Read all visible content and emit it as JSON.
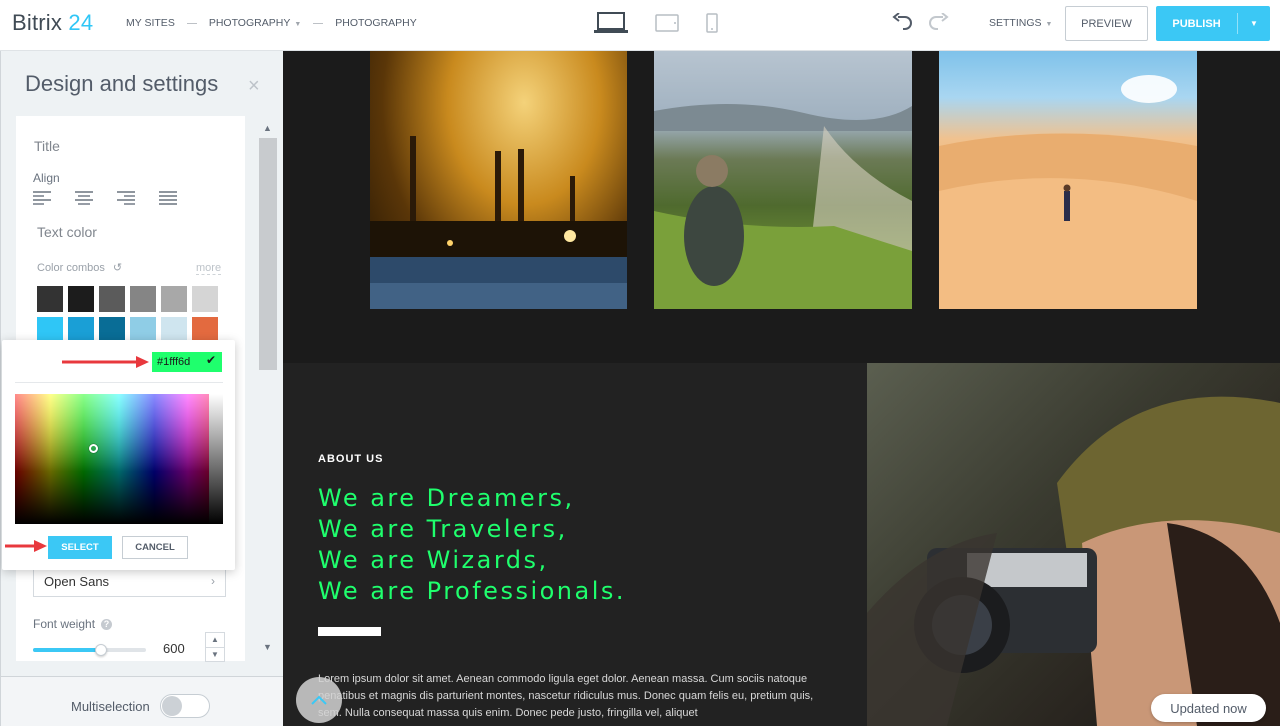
{
  "app": {
    "logo_text": "Bitrix",
    "logo_num": "24"
  },
  "breadcrumb": [
    "MY SITES",
    "PHOTOGRAPHY",
    "PHOTOGRAPHY"
  ],
  "toolbar": {
    "settings_label": "SETTINGS",
    "preview_label": "PREVIEW",
    "publish_label": "PUBLISH"
  },
  "icons": {
    "devices": [
      "laptop-icon",
      "tablet-icon",
      "phone-icon"
    ],
    "undo": "undo-icon",
    "redo": "redo-icon"
  },
  "panel": {
    "title": "Design and settings",
    "close": "×",
    "title_label": "Title",
    "align_label": "Align",
    "text_color_label": "Text color",
    "color_combos_label": "Color combos",
    "more_label": "more",
    "swatches": [
      "#333333",
      "#1c1c1c",
      "#5b5b5b",
      "#858585",
      "#a8a8a8",
      "#d5d5d5",
      "#2fc6f6",
      "#1a9fd6",
      "#096d96",
      "#8fcde6",
      "#cfe5ef",
      "#e36a3f"
    ],
    "font": "Open Sans",
    "font_weight_label": "Font weight",
    "font_weight_value": "600",
    "font_weight_fraction": 0.6,
    "multiselection_label": "Multiselection"
  },
  "picker": {
    "hex_value": "#1fff6d",
    "select_label": "SELECT",
    "cancel_label": "CANCEL"
  },
  "preview": {
    "about_label": "ABOUT US",
    "headline": [
      "We are Dreamers,",
      "We are Travelers,",
      "We are Wizards,",
      "We are Professionals."
    ],
    "body": "Lorem ipsum dolor sit amet. Aenean commodo ligula eget dolor. Aenean massa. Cum sociis natoque penatibus et magnis dis parturient montes, nascetur ridiculus mus. Donec quam felis eu, pretium quis, sem. Nulla consequat massa quis enim. Donec pede justo, fringilla vel, aliquet",
    "updated_label": "Updated now"
  },
  "colors": {
    "accent": "#3bc8f5",
    "headline": "#1fff6d",
    "arrow": "#e8383d"
  }
}
